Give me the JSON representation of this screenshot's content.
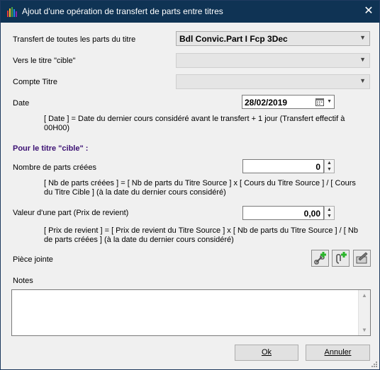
{
  "window": {
    "title": "Ajout d'une opération de transfert de parts entre titres"
  },
  "form": {
    "source_label": "Transfert de toutes les parts du titre",
    "source_value": "Bdl Convic.Part I Fcp 3Dec",
    "target_label": "Vers le titre \"cible\"",
    "target_value": "",
    "account_label": "Compte Titre",
    "account_value": "",
    "date_label": "Date",
    "date_value": "28/02/2019",
    "date_note": "[ Date ] = Date du dernier cours considéré avant le transfert + 1 jour (Transfert effectif à 00H00)",
    "target_section": "Pour le titre \"cible\" :",
    "shares_label": "Nombre de parts créées",
    "shares_value": "0",
    "shares_note": "[ Nb de parts créées ] = [ Nb de parts du Titre Source ] x [ Cours du Titre Source ] / [ Cours du Titre Cible ]   (à la date du dernier cours considéré)",
    "unit_value_label": "Valeur d'une part (Prix de revient)",
    "unit_value_value": "0,00",
    "unit_value_note": "[ Prix de revient ] = [ Prix de revient du Titre Source ] x [ Nb de parts du Titre Source ] / [ Nb de parts créées ]   (à la date du dernier cours considéré)",
    "attachment_label": "Pièce jointe",
    "notes_label": "Notes",
    "notes_value": ""
  },
  "buttons": {
    "ok_label": "Ok",
    "cancel_label": "Annuler"
  },
  "icons": {
    "app": "bar-chart-icon",
    "close": "close-icon",
    "calendar": "calendar-icon",
    "attach_link": "add-link-icon",
    "attach_file": "add-paperclip-icon",
    "attach_edit": "edit-attachment-icon"
  },
  "colors": {
    "titlebar": "#0f3354",
    "section_title": "#3b1073",
    "add_plus": "#2bb52b"
  }
}
